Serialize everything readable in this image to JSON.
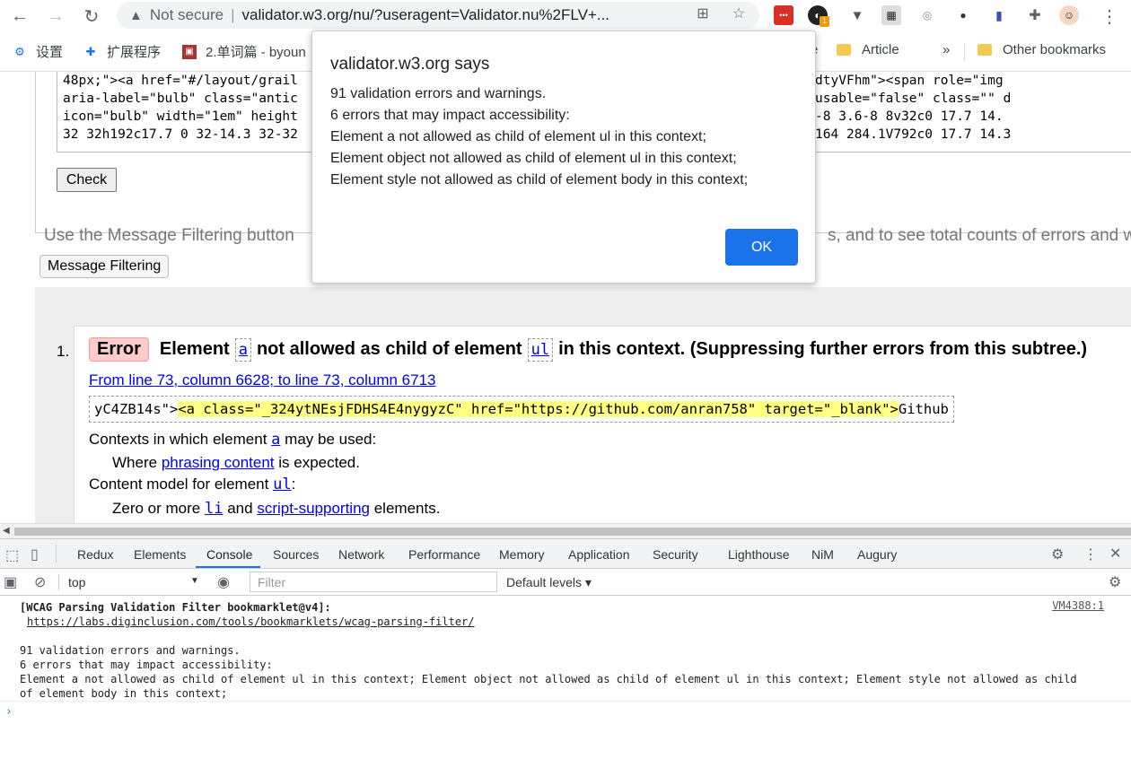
{
  "browser": {
    "not_secure": "Not secure",
    "separator": "|",
    "url": "validator.w3.org/nu/?useragent=Validator.nu%2FLV+...",
    "extension_badge": "1"
  },
  "bookmarks": {
    "items": [
      "设置",
      "扩展程序",
      "2.单词篇 - byoun"
    ],
    "partial_e": "e",
    "article": "Article",
    "overflow": "»",
    "other": "Other bookmarks"
  },
  "page": {
    "source_lines": [
      "48px;\"><a href=\"#/layout/grail                                                    tXm9Jhp5k2XbaFdtyVFhm\"><span role=\"img",
      "aria-label=\"bulb\" class=\"antic                                                    4 896 896\" focusable=\"false\" class=\"\" d",
      "icon=\"bulb\" width=\"1em\" height                                                    888H392c-4.4 0-8 3.6-8 8v32c0 17.7 14.",
      "32 32h192c17.7 0 32-14.3 32-32                                                    21.4 66 227.4 164 284.1V792c0 17.7 14.3"
    ],
    "check_label": "Check",
    "hint_left": "Use the Message Filtering button",
    "hint_right": "s, and to see total counts of errors and w",
    "message_filtering_label": "Message Filtering",
    "message": {
      "number": "1.",
      "badge": "Error",
      "t1": "Element",
      "el1": "a",
      "t2": "not allowed as child of element",
      "el2": "ul",
      "t3": "in this context. (Suppressing further errors from this subtree.)",
      "location": "From line 73, column 6628; to line 73, column 6713",
      "extract_pre": "yC4ZB14s\">",
      "extract_hl": "<a class=\"_324ytNEsjFDHS4E4nygyzC\" href=\"https://github.com/anran758\" target=\"_blank\">",
      "extract_post": "Github",
      "ctx_label": "Contexts in which element",
      "ctx_el": "a",
      "ctx_suffix": "may be used:",
      "where": "Where",
      "where_link": "phrasing content",
      "where_suffix": "is expected.",
      "cm_label": "Content model for element",
      "cm_el": "ul",
      "cm_suffix": ":",
      "zero": "Zero or more",
      "zero_li": "li",
      "zero_and": "and",
      "zero_link": "script-supporting",
      "zero_suffix": "elements."
    }
  },
  "devtools": {
    "tabs": [
      "Redux",
      "Elements",
      "Console",
      "Sources",
      "Network",
      "Performance",
      "Memory",
      "Application",
      "Security",
      "Lighthouse",
      "NiM",
      "Augury"
    ],
    "active_tab": "Console",
    "context": "top",
    "filter_placeholder": "Filter",
    "levels": "Default levels ▾",
    "console": {
      "header": "[WCAG Parsing Validation Filter bookmarklet@v4]:",
      "link": "https://labs.diginclusion.com/tools/bookmarklets/wcag-parsing-filter/",
      "source": "VM4388:1",
      "line1": "91 validation errors and warnings.",
      "line2": "6 errors that may impact accessibility:",
      "line3": "Element a not allowed as child of element ul in this context; Element object not allowed as child of element ul in this context; Element style not allowed as child",
      "line4": "of element body in this context;"
    }
  },
  "dialog": {
    "title": "validator.w3.org says",
    "lines": [
      "91 validation errors and warnings.",
      "6 errors that may impact accessibility:",
      "Element a not allowed as child of element ul in this context;",
      "Element object not allowed as child of element ul in this context;",
      "Element style not allowed as child of element body in this context;"
    ],
    "ok": "OK"
  }
}
